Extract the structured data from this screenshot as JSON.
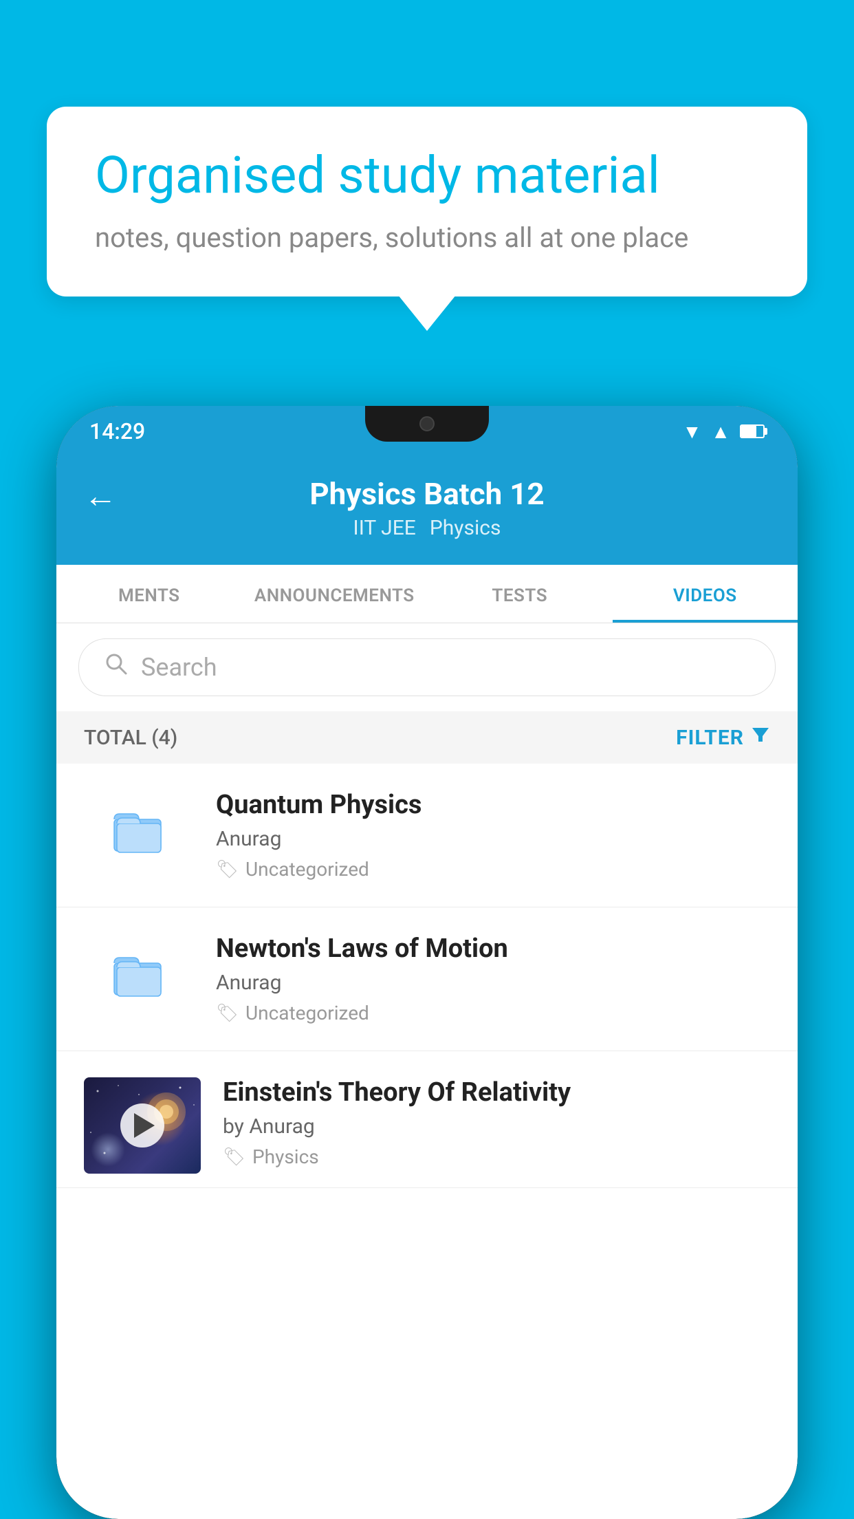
{
  "background_color": "#00b8e6",
  "speech_bubble": {
    "title": "Organised study material",
    "subtitle": "notes, question papers, solutions all at one place"
  },
  "phone": {
    "status_bar": {
      "time": "14:29",
      "icons": [
        "wifi",
        "signal",
        "battery"
      ]
    },
    "header": {
      "title": "Physics Batch 12",
      "subtitle_left": "IIT JEE",
      "subtitle_right": "Physics",
      "back_label": "←"
    },
    "tabs": [
      {
        "label": "MENTS",
        "active": false
      },
      {
        "label": "ANNOUNCEMENTS",
        "active": false
      },
      {
        "label": "TESTS",
        "active": false
      },
      {
        "label": "VIDEOS",
        "active": true
      }
    ],
    "search": {
      "placeholder": "Search"
    },
    "filter_bar": {
      "total_label": "TOTAL (4)",
      "filter_label": "FILTER"
    },
    "videos": [
      {
        "id": 1,
        "title": "Quantum Physics",
        "author": "Anurag",
        "tag": "Uncategorized",
        "thumb_type": "folder"
      },
      {
        "id": 2,
        "title": "Newton's Laws of Motion",
        "author": "Anurag",
        "tag": "Uncategorized",
        "thumb_type": "folder"
      },
      {
        "id": 3,
        "title": "Einstein's Theory Of Relativity",
        "author": "by Anurag",
        "tag": "Physics",
        "thumb_type": "video"
      }
    ]
  }
}
